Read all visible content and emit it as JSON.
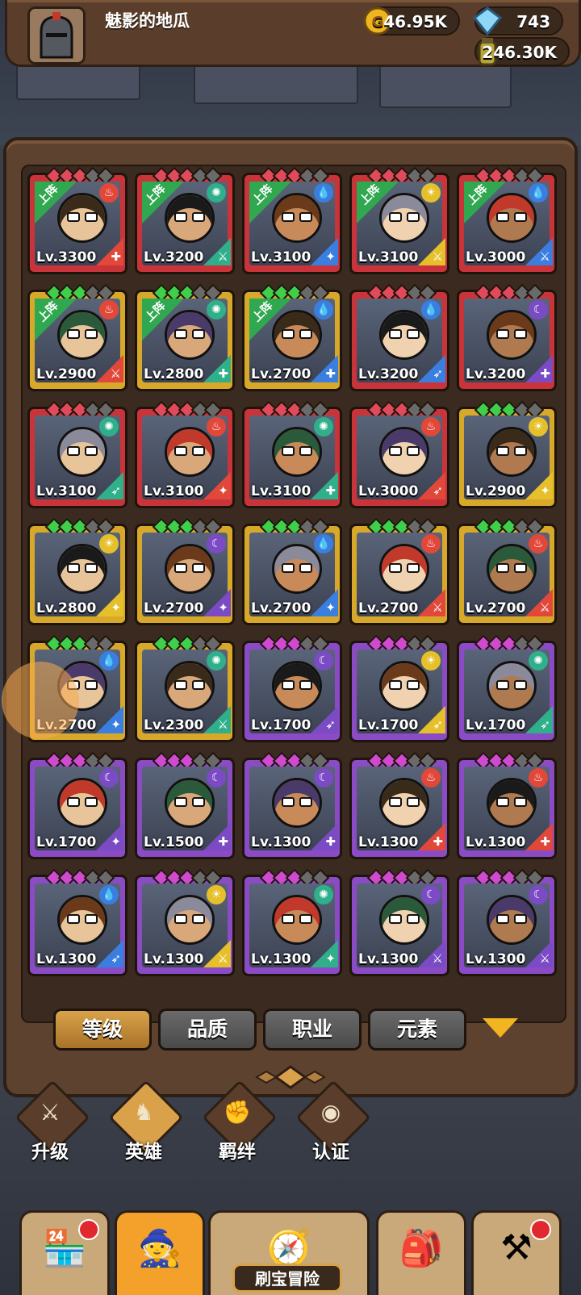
{
  "player": {
    "name": "魅影的地瓜"
  },
  "resources": {
    "gold": "46.95K",
    "gems": "743",
    "potion": "246.30K"
  },
  "heroes": [
    {
      "lv": "Lv.3300",
      "frame": "red",
      "deployed": true,
      "element": "fire",
      "class": "tank"
    },
    {
      "lv": "Lv.3200",
      "frame": "red",
      "deployed": true,
      "element": "wind",
      "class": "sword"
    },
    {
      "lv": "Lv.3100",
      "frame": "red",
      "deployed": true,
      "element": "water",
      "class": "mage"
    },
    {
      "lv": "Lv.3100",
      "frame": "red",
      "deployed": true,
      "element": "light",
      "class": "sword"
    },
    {
      "lv": "Lv.3000",
      "frame": "red",
      "deployed": true,
      "element": "water",
      "class": "sword"
    },
    {
      "lv": "Lv.2900",
      "frame": "gold",
      "deployed": true,
      "element": "fire",
      "class": "sword"
    },
    {
      "lv": "Lv.2800",
      "frame": "gold",
      "deployed": true,
      "element": "wind",
      "class": "tank"
    },
    {
      "lv": "Lv.2700",
      "frame": "gold",
      "deployed": true,
      "element": "water",
      "class": "tank"
    },
    {
      "lv": "Lv.3200",
      "frame": "red",
      "deployed": false,
      "element": "water",
      "class": "bow"
    },
    {
      "lv": "Lv.3200",
      "frame": "red",
      "deployed": false,
      "element": "dark",
      "class": "tank"
    },
    {
      "lv": "Lv.3100",
      "frame": "red",
      "deployed": false,
      "element": "wind",
      "class": "bow"
    },
    {
      "lv": "Lv.3100",
      "frame": "red",
      "deployed": false,
      "element": "fire",
      "class": "mage"
    },
    {
      "lv": "Lv.3100",
      "frame": "red",
      "deployed": false,
      "element": "wind",
      "class": "tank"
    },
    {
      "lv": "Lv.3000",
      "frame": "red",
      "deployed": false,
      "element": "fire",
      "class": "bow"
    },
    {
      "lv": "Lv.2900",
      "frame": "gold",
      "deployed": false,
      "element": "light",
      "class": "mage"
    },
    {
      "lv": "Lv.2800",
      "frame": "gold",
      "deployed": false,
      "element": "light",
      "class": "mage"
    },
    {
      "lv": "Lv.2700",
      "frame": "gold",
      "deployed": false,
      "element": "dark",
      "class": "mage"
    },
    {
      "lv": "Lv.2700",
      "frame": "gold",
      "deployed": false,
      "element": "water",
      "class": "mage"
    },
    {
      "lv": "Lv.2700",
      "frame": "gold",
      "deployed": false,
      "element": "fire",
      "class": "sword"
    },
    {
      "lv": "Lv.2700",
      "frame": "gold",
      "deployed": false,
      "element": "fire",
      "class": "sword"
    },
    {
      "lv": "Lv.2700",
      "frame": "gold",
      "deployed": false,
      "element": "water",
      "class": "mage"
    },
    {
      "lv": "Lv.2300",
      "frame": "gold",
      "deployed": false,
      "element": "wind",
      "class": "sword"
    },
    {
      "lv": "Lv.1700",
      "frame": "purple",
      "deployed": false,
      "element": "dark",
      "class": "bow"
    },
    {
      "lv": "Lv.1700",
      "frame": "purple",
      "deployed": false,
      "element": "light",
      "class": "bow"
    },
    {
      "lv": "Lv.1700",
      "frame": "purple",
      "deployed": false,
      "element": "wind",
      "class": "bow"
    },
    {
      "lv": "Lv.1700",
      "frame": "purple",
      "deployed": false,
      "element": "dark",
      "class": "mage"
    },
    {
      "lv": "Lv.1500",
      "frame": "purple",
      "deployed": false,
      "element": "dark",
      "class": "tank"
    },
    {
      "lv": "Lv.1300",
      "frame": "purple",
      "deployed": false,
      "element": "dark",
      "class": "tank"
    },
    {
      "lv": "Lv.1300",
      "frame": "purple",
      "deployed": false,
      "element": "fire",
      "class": "tank"
    },
    {
      "lv": "Lv.1300",
      "frame": "purple",
      "deployed": false,
      "element": "fire",
      "class": "tank"
    },
    {
      "lv": "Lv.1300",
      "frame": "purple",
      "deployed": false,
      "element": "water",
      "class": "bow"
    },
    {
      "lv": "Lv.1300",
      "frame": "purple",
      "deployed": false,
      "element": "light",
      "class": "sword"
    },
    {
      "lv": "Lv.1300",
      "frame": "purple",
      "deployed": false,
      "element": "wind",
      "class": "mage"
    },
    {
      "lv": "Lv.1300",
      "frame": "purple",
      "deployed": false,
      "element": "dark",
      "class": "sword"
    },
    {
      "lv": "Lv.1300",
      "frame": "purple",
      "deployed": false,
      "element": "dark",
      "class": "sword"
    }
  ],
  "deployed_label": "上阵",
  "sort_tabs": [
    {
      "label": "等级",
      "active": true
    },
    {
      "label": "品质",
      "active": false
    },
    {
      "label": "职业",
      "active": false
    },
    {
      "label": "元素",
      "active": false
    }
  ],
  "sub_nav": [
    {
      "label": "升级",
      "icon": "sword-icon",
      "active": false
    },
    {
      "label": "英雄",
      "icon": "hero-icon",
      "active": true
    },
    {
      "label": "羁绊",
      "icon": "handshake-icon",
      "active": false
    },
    {
      "label": "认证",
      "icon": "eye-icon",
      "active": false
    }
  ],
  "bottom_nav": {
    "adventure_label": "刷宝冒险",
    "items": [
      "shop-icon",
      "hero-avatar-icon",
      "adventure-map-icon",
      "backpack-icon",
      "forge-icon"
    ]
  },
  "colors": {
    "frame_red": "#c9343a",
    "frame_gold": "#d8a82a",
    "frame_purple": "#8a4bc4",
    "el_fire": "#e2483a",
    "el_water": "#3a7fe0",
    "el_wind": "#2fb08a",
    "el_light": "#e6c02a",
    "el_dark": "#7a4bc4"
  }
}
